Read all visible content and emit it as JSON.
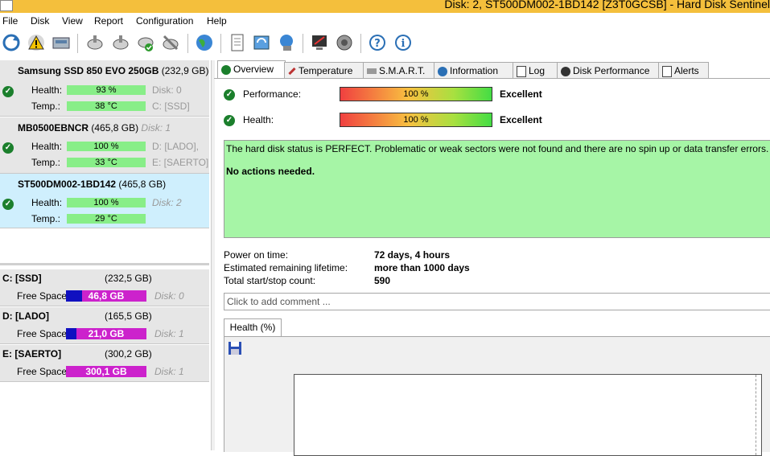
{
  "window": {
    "title": "Disk: 2, ST500DM002-1BD142 [Z3T0GCSB]  -  Hard Disk Sentinel"
  },
  "menu": [
    "File",
    "Disk",
    "View",
    "Report",
    "Configuration",
    "Help"
  ],
  "toolbar": {
    "buttons": [
      "refresh-icon",
      "warning-icon",
      "drive-icon",
      "disk-tool-icon",
      "disk-tool-icon",
      "disk-check-icon",
      "disk-tool-icon",
      "globe-icon",
      "document-icon",
      "update-icon",
      "network-icon",
      "report-icon",
      "speaker-icon",
      "help-icon",
      "info-icon"
    ]
  },
  "disks": [
    {
      "name": "Samsung SSD 850 EVO 250GB",
      "size": "(232,9 GB)",
      "health_label": "Health:",
      "health": "93 %",
      "health_value": 0.93,
      "temp_label": "Temp.:",
      "temp": "38 °C",
      "disk_no": "Disk: 0",
      "volumes": [
        "C: [SSD]"
      ]
    },
    {
      "name": "MB0500EBNCR",
      "size": "(465,8 GB)",
      "disk_no": "Disk: 1",
      "health_label": "Health:",
      "health": "100 %",
      "health_value": 1.0,
      "temp_label": "Temp.:",
      "temp": "33 °C",
      "volumes": [
        "D: [LADO],",
        "E: [SAERTO]"
      ]
    },
    {
      "name": "ST500DM002-1BD142",
      "size": "(465,8 GB)",
      "health_label": "Health:",
      "health": "100 %",
      "health_value": 1.0,
      "temp_label": "Temp.:",
      "temp": "29 °C",
      "disk_no": "Disk: 2"
    }
  ],
  "volumes": [
    {
      "name": "C: [SSD]",
      "size": "(232,5 GB)",
      "free_label": "Free Space",
      "free": "46,8 GB",
      "free_fraction": 0.2,
      "disk": "Disk: 0",
      "color": "#1010c0"
    },
    {
      "name": "D: [LADO]",
      "size": "(165,5 GB)",
      "free_label": "Free Space",
      "free": "21,0 GB",
      "free_fraction": 0.13,
      "disk": "Disk: 1",
      "color": "#1010c0"
    },
    {
      "name": "E: [SAERTO]",
      "size": "(300,2 GB)",
      "free_label": "Free Space",
      "free": "300,1 GB",
      "free_fraction": 1.0,
      "disk": "Disk: 1",
      "color": "#cc22cc"
    }
  ],
  "tabs": [
    "Overview",
    "Temperature",
    "S.M.A.R.T.",
    "Information",
    "Log",
    "Disk Performance",
    "Alerts"
  ],
  "overview": {
    "performance_label": "Performance:",
    "performance": "100 %",
    "performance_rating": "Excellent",
    "health_label": "Health:",
    "health": "100 %",
    "health_rating": "Excellent",
    "status_text": "The hard disk status is PERFECT. Problematic or weak sectors were not found and there are no spin up or data transfer errors.",
    "action_text": "No actions needed.",
    "power_on_label": "Power on time:",
    "power_on": "72 days, 4 hours",
    "lifetime_label": "Estimated remaining lifetime:",
    "lifetime": "more than 1000 days",
    "startstop_label": "Total start/stop count:",
    "startstop": "590",
    "comment_placeholder": "Click to add comment ...",
    "health_tab": "Health (%)"
  },
  "colors": {
    "titlebar": "#f4bf3c",
    "health_bar": "#88ee88",
    "status_bg": "#a6f5a6",
    "selected_disk": "#cfeffd"
  }
}
